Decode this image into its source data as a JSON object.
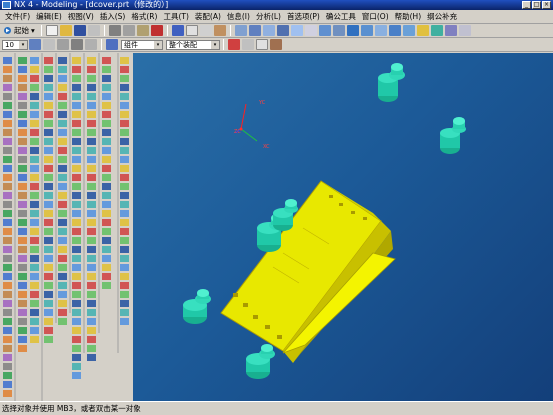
{
  "window": {
    "title": "NX 4 - Modeling - [dcover.prt（修改的）]"
  },
  "menu": {
    "items": [
      "文件(F)",
      "编辑(E)",
      "视图(V)",
      "插入(S)",
      "格式(R)",
      "工具(T)",
      "装配(A)",
      "信息(I)",
      "分析(L)",
      "首选项(P)",
      "确公工具",
      "窗口(O)",
      "帮助(H)",
      "纲公补充"
    ]
  },
  "toolbar": {
    "start_label": "起始",
    "layer_value": "10",
    "filter_value": "组件",
    "scope_value": "整个装配"
  },
  "viewport": {
    "triad": {
      "y_label": "YC",
      "x_label": "XC",
      "z_label": "ZC"
    },
    "background_top": "#2a6fa8",
    "background_bottom": "#133f7a",
    "part_color": "#f0f000",
    "peg_color": "#20d0b0"
  },
  "status": {
    "message": "选择对象并使用 MB3，或者双击某一对象"
  },
  "icons": {
    "app": "nx-app-icon",
    "minimize": "minimize-icon",
    "maximize": "maximize-icon",
    "close": "close-icon"
  }
}
